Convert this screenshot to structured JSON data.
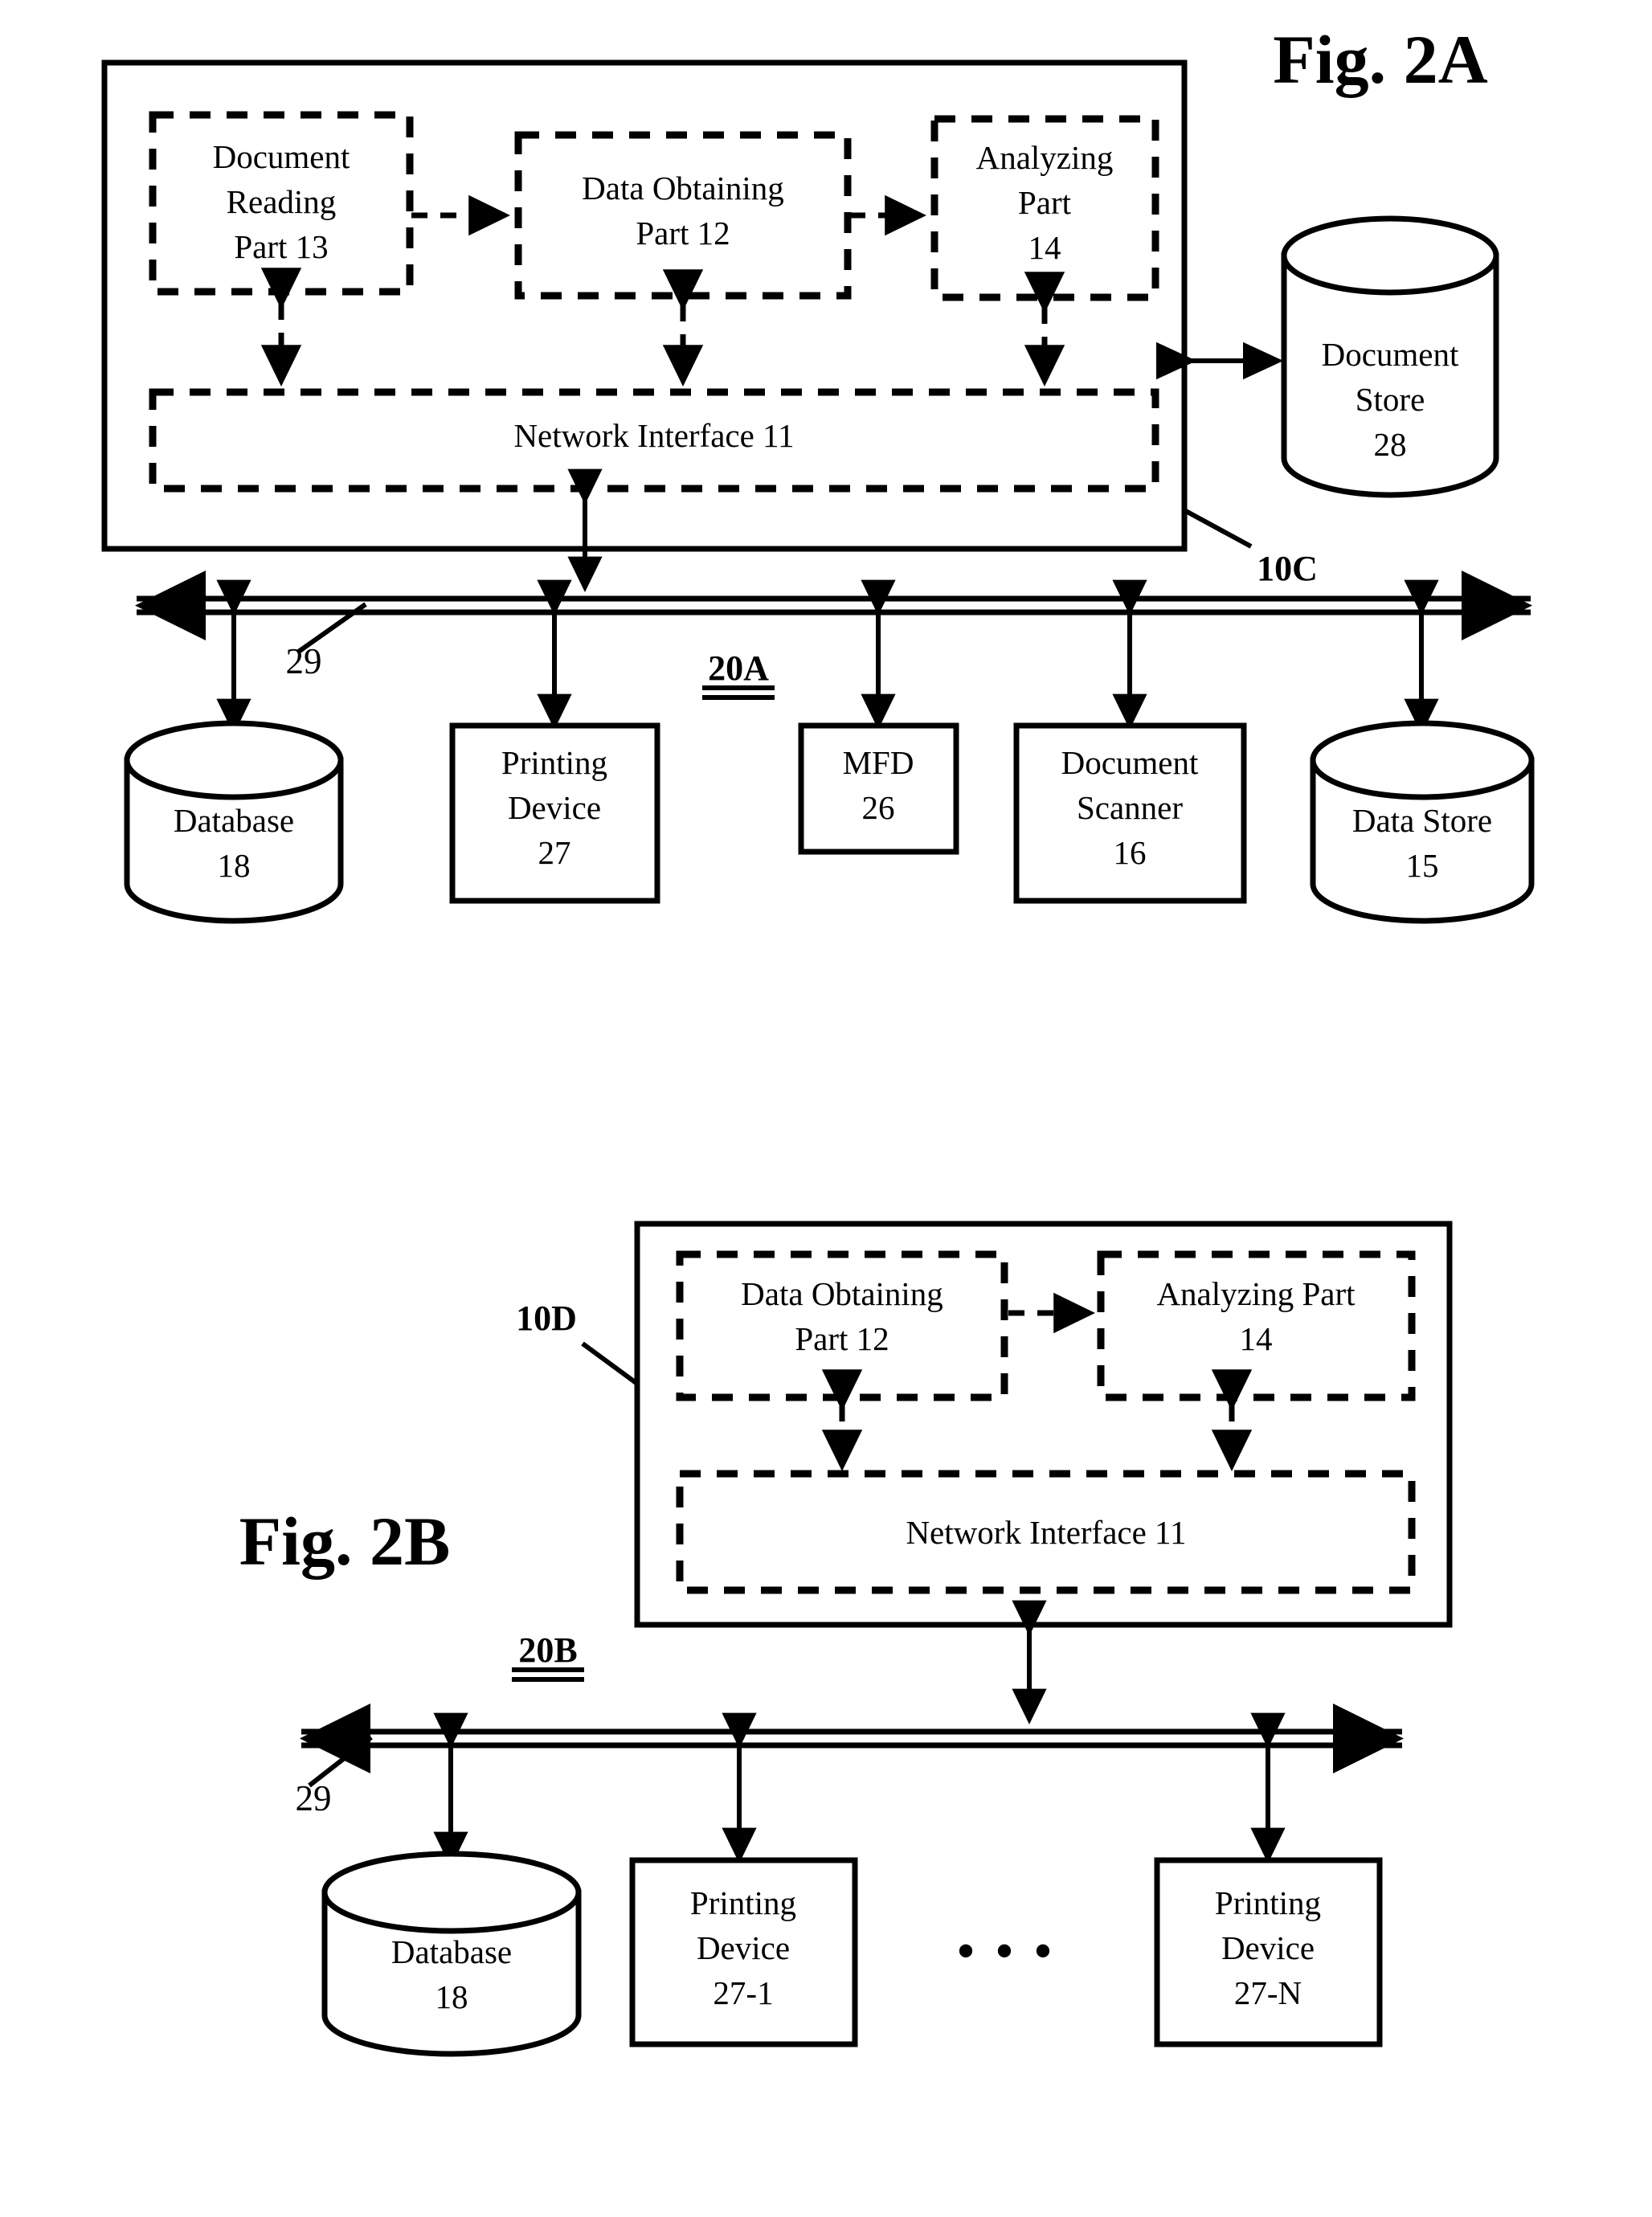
{
  "figures": [
    {
      "id": "fig-2a",
      "title": "Fig. 2A",
      "system_ref": "10C",
      "network_ref": "20A",
      "bus_ref": "29",
      "modules": [
        {
          "name": "document-reading-part",
          "line1": "Document",
          "line2": "Reading",
          "line3": "Part 13"
        },
        {
          "name": "data-obtaining-part",
          "line1": "Data Obtaining",
          "line2": "Part 12",
          "line3": ""
        },
        {
          "name": "analyzing-part",
          "line1": "Analyzing",
          "line2": "Part",
          "line3": "14"
        },
        {
          "name": "network-interface",
          "line1": "Network Interface 11",
          "line2": "",
          "line3": ""
        }
      ],
      "side_store": {
        "name": "document-store",
        "line1": "Document",
        "line2": "Store",
        "line3": "28"
      },
      "devices": [
        {
          "name": "database",
          "shape": "cylinder",
          "line1": "Database",
          "line2": "18"
        },
        {
          "name": "printing-device",
          "shape": "rect",
          "line1": "Printing",
          "line2": "Device",
          "line3": "27"
        },
        {
          "name": "mfd",
          "shape": "rect",
          "line1": "MFD",
          "line2": "26",
          "line3": ""
        },
        {
          "name": "document-scanner",
          "shape": "rect",
          "line1": "Document",
          "line2": "Scanner",
          "line3": "16"
        },
        {
          "name": "data-store",
          "shape": "cylinder",
          "line1": "Data Store",
          "line2": "15"
        }
      ]
    },
    {
      "id": "fig-2b",
      "title": "Fig. 2B",
      "system_ref": "10D",
      "network_ref": "20B",
      "bus_ref": "29",
      "modules": [
        {
          "name": "data-obtaining-part",
          "line1": "Data Obtaining",
          "line2": "Part 12"
        },
        {
          "name": "analyzing-part",
          "line1": "Analyzing Part",
          "line2": "14"
        },
        {
          "name": "network-interface",
          "line1": "Network Interface 11",
          "line2": ""
        }
      ],
      "devices": [
        {
          "name": "database",
          "shape": "cylinder",
          "line1": "Database",
          "line2": "18"
        },
        {
          "name": "printing-device-1",
          "shape": "rect",
          "line1": "Printing",
          "line2": "Device",
          "line3": "27-1"
        },
        {
          "name": "ellipsis",
          "shape": "text",
          "line1": "• • •"
        },
        {
          "name": "printing-device-n",
          "shape": "rect",
          "line1": "Printing",
          "line2": "Device",
          "line3": "27-N"
        }
      ]
    }
  ],
  "colors": {
    "ink": "#000000",
    "paper": "#ffffff"
  }
}
